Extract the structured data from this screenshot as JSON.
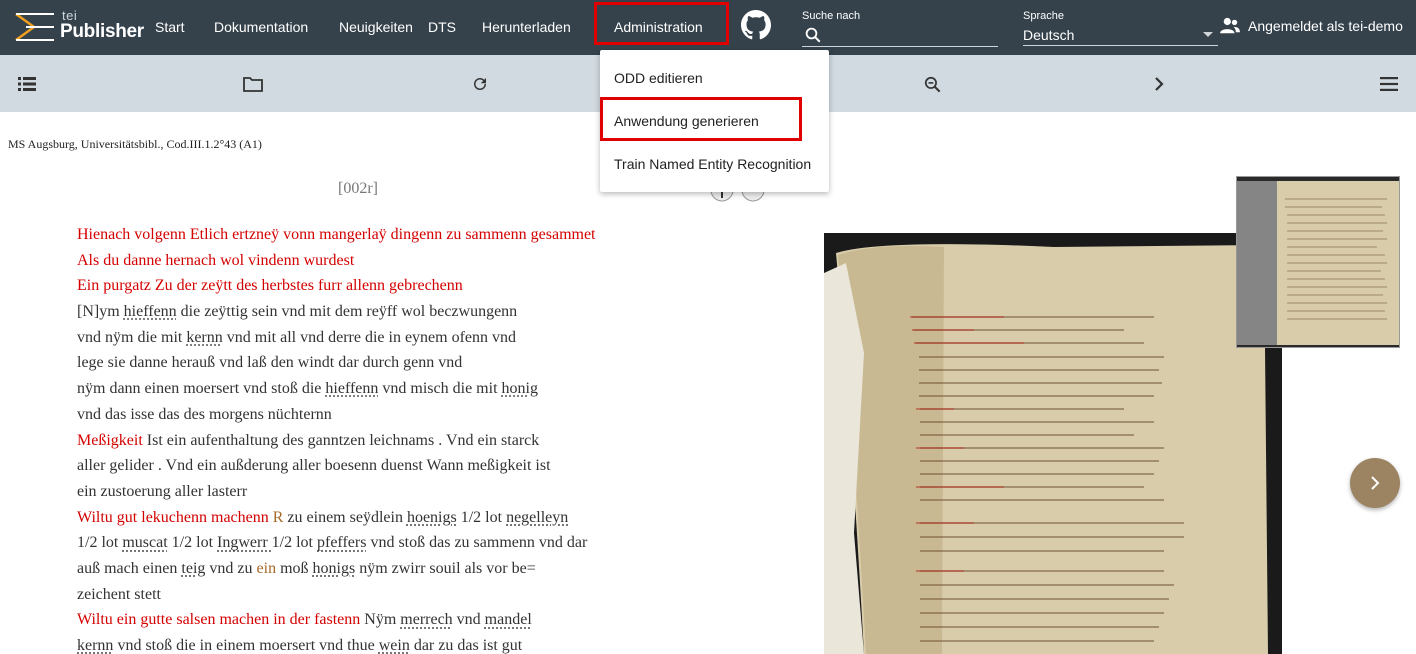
{
  "logo": {
    "tei": "tei",
    "publisher": "Publisher"
  },
  "nav": {
    "start": "Start",
    "docs": "Dokumentation",
    "news": "Neuigkeiten",
    "dts": "DTS",
    "download": "Herunterladen",
    "admin": "Administration"
  },
  "search": {
    "label": "Suche nach",
    "value": ""
  },
  "language": {
    "label": "Sprache",
    "value": "Deutsch"
  },
  "user": {
    "text": "Angemeldet als tei-demo"
  },
  "admin_menu": {
    "items": [
      "ODD editieren",
      "Anwendung generieren",
      "Train Named Entity Recognition"
    ],
    "highlighted": "Anwendung generieren"
  },
  "toolbar": {
    "icons": [
      "list-icon",
      "folder-icon",
      "reload-icon",
      "zoom-out-icon",
      "chevron-right-icon",
      "menu-icon"
    ]
  },
  "document": {
    "source": "MS Augsburg, Universitätsbibl., Cod.III.1.2°43 (A1)",
    "page": "[002r]",
    "lines": [
      [
        {
          "t": "Hienach volgenn Etlich ertzneÿ vonn mangerlaÿ dingenn zu sammenn gesammet",
          "s": "red"
        }
      ],
      [
        {
          "t": "Als du danne hernach wol vindenn wurdest",
          "s": "red"
        }
      ],
      [
        {
          "t": "Ein purgatz Zu der zeÿtt des herbstes furr allenn gebrechenn",
          "s": "red"
        }
      ],
      [
        {
          "t": "[N]ym ",
          "s": ""
        },
        {
          "t": "hieffenn",
          "s": "u"
        },
        {
          "t": " die zeÿttig sein vnd mit dem reÿff wol beczwungenn",
          "s": ""
        }
      ],
      [
        {
          "t": "vnd nÿm die mit ",
          "s": ""
        },
        {
          "t": "kernn",
          "s": "u"
        },
        {
          "t": " vnd mit all vnd derre die in eynem ofenn vnd",
          "s": ""
        }
      ],
      [
        {
          "t": "lege sie danne herauß vnd laß den windt dar durch genn vnd",
          "s": ""
        }
      ],
      [
        {
          "t": "nÿm dann einen moersert vnd stoß die ",
          "s": ""
        },
        {
          "t": "hieffenn",
          "s": "u"
        },
        {
          "t": " vnd misch die mit ",
          "s": ""
        },
        {
          "t": "honig",
          "s": "u"
        }
      ],
      [
        {
          "t": "vnd das isse das des morgens nüchternn",
          "s": ""
        }
      ],
      [
        {
          "t": "Meßigkeit",
          "s": "red"
        },
        {
          "t": " Ist ein aufenthaltung des ganntzen leichnams . Vnd ein starck",
          "s": ""
        }
      ],
      [
        {
          "t": "aller gelider . Vnd ein außderung aller boesenn duenst Wann meßigkeit ist",
          "s": ""
        }
      ],
      [
        {
          "t": "ein zustoerung aller lasterr",
          "s": ""
        }
      ],
      [
        {
          "t": "Wiltu gut lekuchenn machenn",
          "s": "red"
        },
        {
          "t": " ",
          "s": ""
        },
        {
          "t": "R",
          "s": "brown"
        },
        {
          "t": " zu einem seÿdlein ",
          "s": ""
        },
        {
          "t": "hoenigs",
          "s": "u"
        },
        {
          "t": " 1/2 lot ",
          "s": ""
        },
        {
          "t": "negelleyn",
          "s": "u"
        }
      ],
      [
        {
          "t": "1/2 lot ",
          "s": ""
        },
        {
          "t": "muscat",
          "s": "u"
        },
        {
          "t": " 1/2 lot ",
          "s": ""
        },
        {
          "t": "Ingwerr ",
          "s": "u"
        },
        {
          "t": "1/2 lot ",
          "s": ""
        },
        {
          "t": "pfeffers",
          "s": "u"
        },
        {
          "t": " vnd stoß das zu sammenn vnd dar",
          "s": ""
        }
      ],
      [
        {
          "t": "auß mach einen ",
          "s": ""
        },
        {
          "t": "teig",
          "s": "u"
        },
        {
          "t": " vnd zu ",
          "s": ""
        },
        {
          "t": "ein",
          "s": "brown"
        },
        {
          "t": " moß ",
          "s": ""
        },
        {
          "t": "honigs",
          "s": "u"
        },
        {
          "t": " nÿm zwirr souil als vor be=",
          "s": ""
        }
      ],
      [
        {
          "t": "zeichent stett",
          "s": ""
        }
      ],
      [
        {
          "t": "Wiltu ein gutte salsen machen in der fastenn",
          "s": "red"
        },
        {
          "t": " Nÿm ",
          "s": ""
        },
        {
          "t": "merrech",
          "s": "u"
        },
        {
          "t": " vnd ",
          "s": ""
        },
        {
          "t": "mandel",
          "s": "u"
        }
      ],
      [
        {
          "t": "kernn",
          "s": "u"
        },
        {
          "t": " vnd stoß die in einem moersert vnd thue ",
          "s": ""
        },
        {
          "t": "wein",
          "s": "u"
        },
        {
          "t": " dar zu das ist gut",
          "s": ""
        }
      ]
    ]
  },
  "colors": {
    "topbar": "#35424b",
    "toolbar": "#d1dae0",
    "rubric": "#d40000",
    "highlight": "#e00000",
    "next_button": "#9c8463"
  }
}
